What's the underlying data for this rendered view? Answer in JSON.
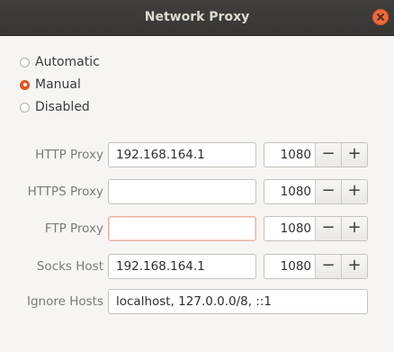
{
  "window": {
    "title": "Network Proxy"
  },
  "mode": {
    "options": [
      {
        "label": "Automatic",
        "checked": false
      },
      {
        "label": "Manual",
        "checked": true
      },
      {
        "label": "Disabled",
        "checked": false
      }
    ]
  },
  "proxies": {
    "http": {
      "label": "HTTP Proxy",
      "host": "192.168.164.1",
      "port": "1080"
    },
    "https": {
      "label": "HTTPS Proxy",
      "host": "",
      "port": "1080"
    },
    "ftp": {
      "label": "FTP Proxy",
      "host": "",
      "port": "1080"
    },
    "socks": {
      "label": "Socks Host",
      "host": "192.168.164.1",
      "port": "1080"
    }
  },
  "ignore": {
    "label": "Ignore Hosts",
    "value": "localhost, 127.0.0.0/8, ::1"
  },
  "spin_buttons": {
    "minus": "−",
    "plus": "+"
  },
  "colors": {
    "accent": "#e95420",
    "titlebar": "#3c3b37"
  }
}
